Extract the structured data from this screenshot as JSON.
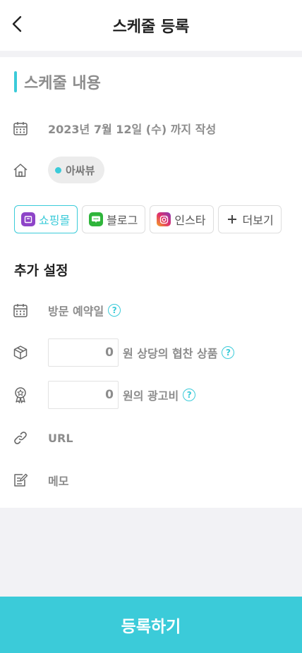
{
  "header": {
    "title": "스케줄 등록"
  },
  "section": {
    "title": "스케줄 내용"
  },
  "deadline": {
    "text": "2023년 7월 12일 (수) 까지 작성"
  },
  "store": {
    "name": "아싸뷰"
  },
  "platforms": [
    {
      "label": "쇼핑몰",
      "icon": "shopping-mall-icon",
      "active": true
    },
    {
      "label": "블로그",
      "icon": "blog-icon",
      "active": false
    },
    {
      "label": "인스타",
      "icon": "instagram-icon",
      "active": false
    },
    {
      "label": "더보기",
      "icon": "plus-icon",
      "active": false
    }
  ],
  "extra": {
    "title": "추가 설정",
    "visit_label": "방문 예약일",
    "product_value": "0",
    "product_label": "원 상당의 협찬 상품",
    "ad_value": "0",
    "ad_label": "원의 광고비",
    "url_label": "URL",
    "memo_label": "메모",
    "help_glyph": "?"
  },
  "submit": {
    "label": "등록하기"
  },
  "colors": {
    "accent": "#3bcbd9",
    "muted": "#8c8c8c",
    "background": "#f2f2f5"
  }
}
